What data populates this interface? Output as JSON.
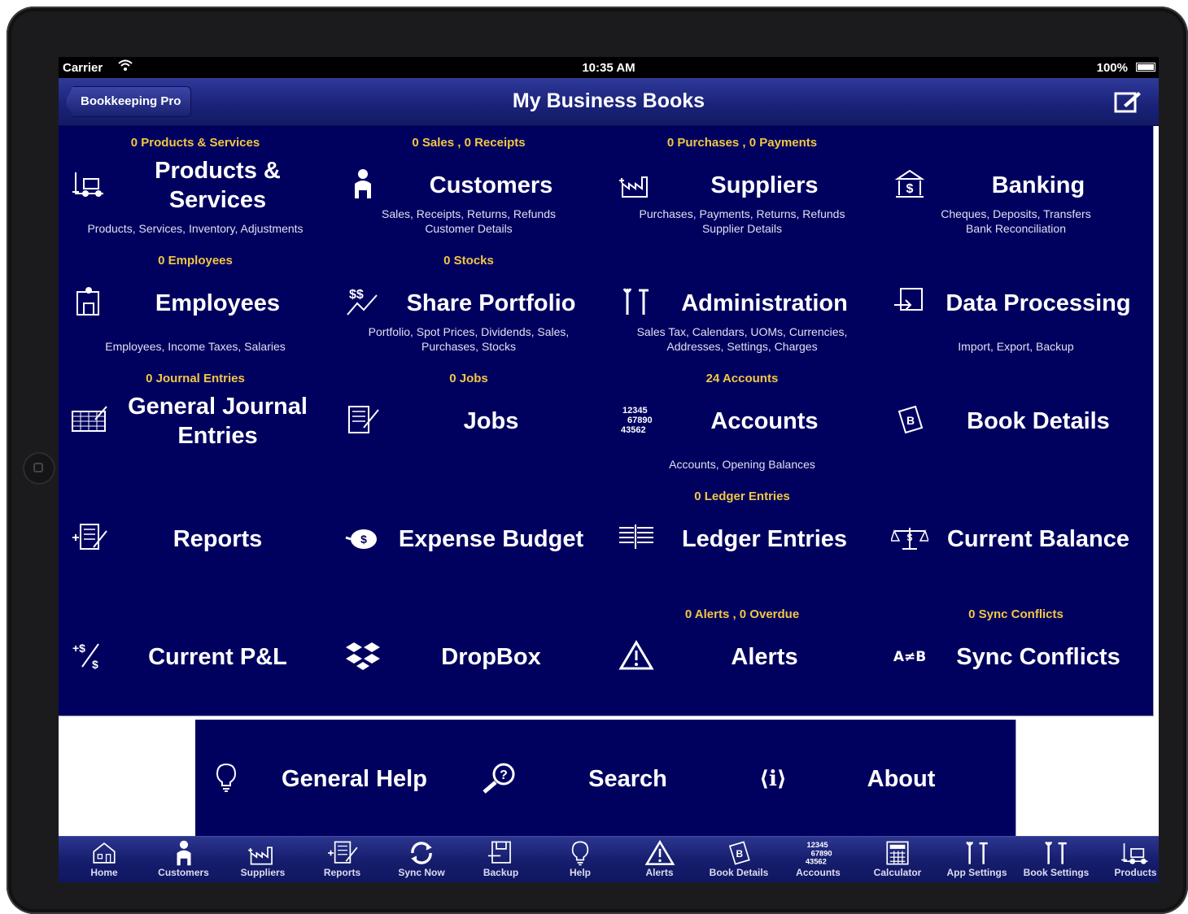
{
  "status": {
    "carrier": "Carrier",
    "time": "10:35 AM",
    "battery": "100%"
  },
  "nav": {
    "back": "Bookkeeping Pro",
    "title": "My Business Books"
  },
  "tiles": [
    {
      "name": "products",
      "count": "0 Products & Services",
      "title": "Products & Services",
      "sub": "Products, Services, Inventory, Adjustments",
      "icon": "forklift-icon"
    },
    {
      "name": "customers",
      "count": "0 Sales , 0 Receipts",
      "title": "Customers",
      "sub": "Sales, Receipts, Returns, Refunds\nCustomer Details",
      "icon": "person-icon"
    },
    {
      "name": "suppliers",
      "count": "0 Purchases , 0 Payments",
      "title": "Suppliers",
      "sub": "Purchases, Payments, Returns, Refunds\nSupplier Details",
      "icon": "factory-icon"
    },
    {
      "name": "banking",
      "count": "",
      "title": "Banking",
      "sub": "Cheques, Deposits, Transfers\nBank Reconciliation",
      "icon": "bank-icon"
    },
    {
      "name": "employees",
      "count": "0 Employees",
      "title": "Employees",
      "sub": "Employees, Income Taxes, Salaries",
      "icon": "worker-icon"
    },
    {
      "name": "share-portfolio",
      "count": "0 Stocks",
      "title": "Share Portfolio",
      "sub": "Portfolio, Spot Prices, Dividends, Sales,\nPurchases, Stocks",
      "icon": "stocks-icon"
    },
    {
      "name": "administration",
      "count": "",
      "title": "Administration",
      "sub": "Sales Tax, Calendars, UOMs, Currencies,\nAddresses, Settings, Charges",
      "icon": "tools-icon"
    },
    {
      "name": "data-processing",
      "count": "",
      "title": "Data Processing",
      "sub": "Import, Export, Backup",
      "icon": "import-icon"
    },
    {
      "name": "general-journal",
      "count": "0 Journal Entries",
      "title": "General Journal Entries",
      "sub": "",
      "icon": "journal-icon"
    },
    {
      "name": "jobs",
      "count": "0 Jobs",
      "title": "Jobs",
      "sub": "",
      "icon": "checklist-icon"
    },
    {
      "name": "accounts",
      "count": "24 Accounts",
      "title": "Accounts",
      "sub": "Accounts, Opening Balances",
      "icon": "numbers-icon"
    },
    {
      "name": "book-details",
      "count": "",
      "title": "Book Details",
      "sub": "",
      "icon": "book-icon"
    },
    {
      "name": "reports",
      "count": "",
      "title": "Reports",
      "sub": "",
      "icon": "report-icon"
    },
    {
      "name": "expense-budget",
      "count": "",
      "title": "Expense Budget",
      "sub": "",
      "icon": "piggy-bank-icon"
    },
    {
      "name": "ledger-entries",
      "count": "0 Ledger Entries",
      "title": "Ledger Entries",
      "sub": "",
      "icon": "ledger-icon"
    },
    {
      "name": "current-balance",
      "count": "",
      "title": "Current Balance",
      "sub": "",
      "icon": "scales-icon"
    },
    {
      "name": "current-pl",
      "count": "",
      "title": "Current P&L",
      "sub": "",
      "icon": "profit-loss-icon"
    },
    {
      "name": "dropbox",
      "count": "",
      "title": "DropBox",
      "sub": "",
      "icon": "dropbox-icon"
    },
    {
      "name": "alerts",
      "count": "0 Alerts , 0 Overdue",
      "title": "Alerts",
      "sub": "",
      "icon": "warning-icon"
    },
    {
      "name": "sync-conflicts",
      "count": "0 Sync Conflicts",
      "title": "Sync Conflicts",
      "sub": "",
      "icon": "not-equal-icon"
    }
  ],
  "bottom_tiles": [
    {
      "name": "general-help",
      "title": "General Help",
      "icon": "lightbulb-icon"
    },
    {
      "name": "search",
      "title": "Search",
      "icon": "search-icon"
    },
    {
      "name": "about",
      "title": "About",
      "icon": "info-icon"
    }
  ],
  "icon_text": {
    "ab": "A≠B",
    "pl": "+$⁄$",
    "info": "⟨i⟩",
    "nums": "12345\n67890\n43562"
  },
  "tabs": [
    {
      "label": "Home",
      "icon": "home-icon"
    },
    {
      "label": "Customers",
      "icon": "person-icon"
    },
    {
      "label": "Suppliers",
      "icon": "factory-icon"
    },
    {
      "label": "Reports",
      "icon": "report-icon"
    },
    {
      "label": "Sync Now",
      "icon": "sync-icon"
    },
    {
      "label": "Backup",
      "icon": "backup-icon"
    },
    {
      "label": "Help",
      "icon": "lightbulb-icon"
    },
    {
      "label": "Alerts",
      "icon": "warning-icon"
    },
    {
      "label": "Book Details",
      "icon": "book-icon"
    },
    {
      "label": "Accounts",
      "icon": "numbers-icon"
    },
    {
      "label": "Calculator",
      "icon": "calculator-icon"
    },
    {
      "label": "App Settings",
      "icon": "tools-icon"
    },
    {
      "label": "Book Settings",
      "icon": "tools-icon"
    },
    {
      "label": "Products",
      "icon": "forklift-icon"
    }
  ]
}
